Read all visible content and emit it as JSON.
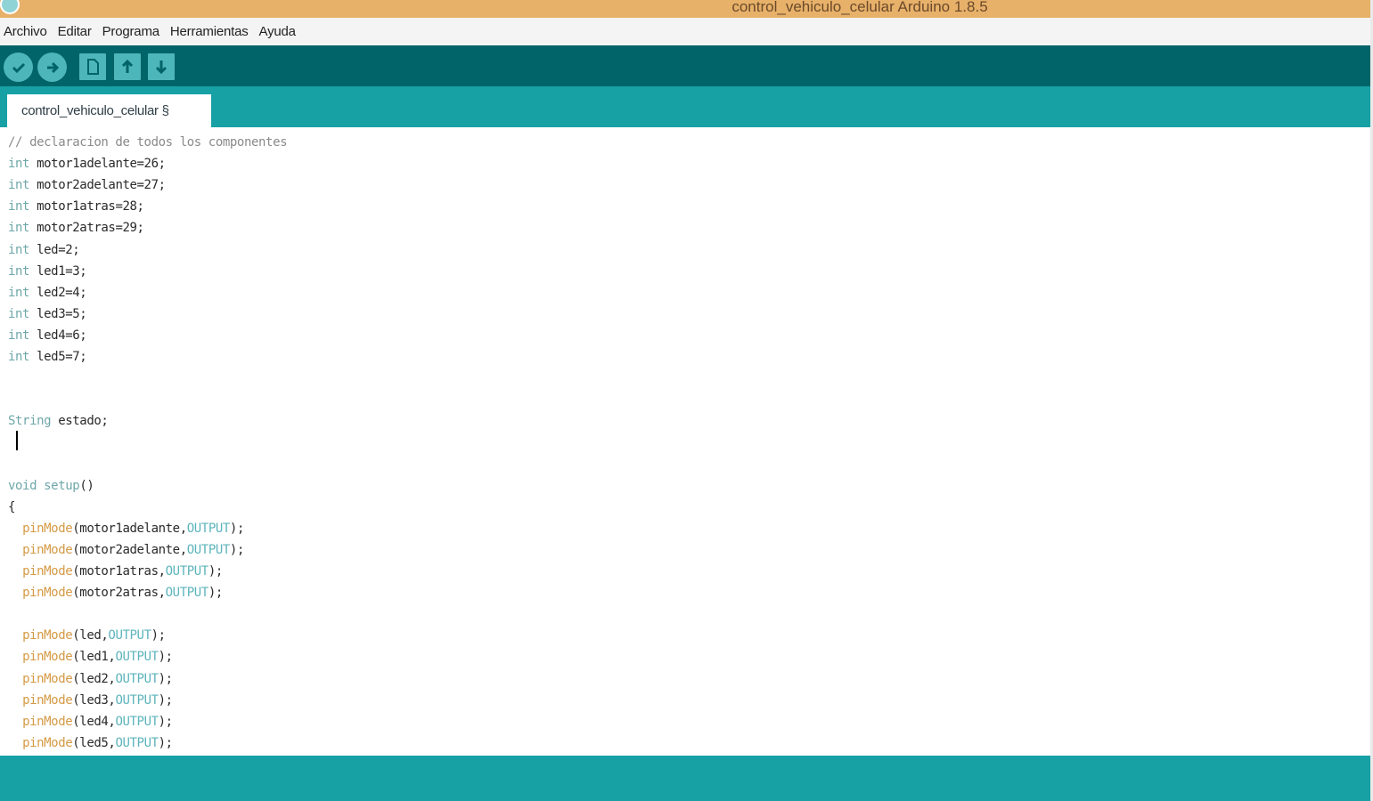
{
  "window": {
    "title": "control_vehiculo_celular Arduino 1.8.5"
  },
  "menu": [
    "Archivo",
    "Editar",
    "Programa",
    "Herramientas",
    "Ayuda"
  ],
  "toolbar": {
    "buttons": [
      {
        "name": "verify",
        "icon": "check-icon",
        "glyph": "✓"
      },
      {
        "name": "upload",
        "icon": "arrow-right-icon",
        "glyph": "➜"
      },
      {
        "name": "new",
        "icon": "file-icon",
        "glyph": "🗋"
      },
      {
        "name": "open",
        "icon": "arrow-up-icon",
        "glyph": "⬆"
      },
      {
        "name": "save",
        "icon": "arrow-down-icon",
        "glyph": "⬇"
      }
    ]
  },
  "tab": {
    "label": "control_vehiculo_celular §"
  },
  "colors": {
    "titlebar": "#e8b16a",
    "toolbar": "#006468",
    "tabbar": "#17a1a5",
    "keyword": "#6fa7a9",
    "function": "#d59a45",
    "constant": "#5cb4bb"
  },
  "code": [
    [
      {
        "t": "// declaracion de todos los componentes",
        "c": "cm"
      }
    ],
    [
      {
        "t": "int",
        "c": "kw"
      },
      {
        "t": " motor1adelante=26;"
      }
    ],
    [
      {
        "t": "int",
        "c": "kw"
      },
      {
        "t": " motor2adelante=27;"
      }
    ],
    [
      {
        "t": "int",
        "c": "kw"
      },
      {
        "t": " motor1atras=28;"
      }
    ],
    [
      {
        "t": "int",
        "c": "kw"
      },
      {
        "t": " motor2atras=29;"
      }
    ],
    [
      {
        "t": "int",
        "c": "kw"
      },
      {
        "t": " led=2;"
      }
    ],
    [
      {
        "t": "int",
        "c": "kw"
      },
      {
        "t": " led1=3;"
      }
    ],
    [
      {
        "t": "int",
        "c": "kw"
      },
      {
        "t": " led2=4;"
      }
    ],
    [
      {
        "t": "int",
        "c": "kw"
      },
      {
        "t": " led3=5;"
      }
    ],
    [
      {
        "t": "int",
        "c": "kw"
      },
      {
        "t": " led4=6;"
      }
    ],
    [
      {
        "t": "int",
        "c": "kw"
      },
      {
        "t": " led5=7;"
      }
    ],
    [],
    [],
    [
      {
        "t": "String",
        "c": "kw"
      },
      {
        "t": " estado;"
      }
    ],
    [],
    [],
    [
      {
        "t": "void",
        "c": "kw"
      },
      {
        "t": " "
      },
      {
        "t": "setup",
        "c": "kw"
      },
      {
        "t": "()"
      }
    ],
    [
      {
        "t": "{"
      }
    ],
    [
      {
        "t": "  "
      },
      {
        "t": "pinMode",
        "c": "fn"
      },
      {
        "t": "(motor1adelante,"
      },
      {
        "t": "OUTPUT",
        "c": "const"
      },
      {
        "t": ");"
      }
    ],
    [
      {
        "t": "  "
      },
      {
        "t": "pinMode",
        "c": "fn"
      },
      {
        "t": "(motor2adelante,"
      },
      {
        "t": "OUTPUT",
        "c": "const"
      },
      {
        "t": ");"
      }
    ],
    [
      {
        "t": "  "
      },
      {
        "t": "pinMode",
        "c": "fn"
      },
      {
        "t": "(motor1atras,"
      },
      {
        "t": "OUTPUT",
        "c": "const"
      },
      {
        "t": ");"
      }
    ],
    [
      {
        "t": "  "
      },
      {
        "t": "pinMode",
        "c": "fn"
      },
      {
        "t": "(motor2atras,"
      },
      {
        "t": "OUTPUT",
        "c": "const"
      },
      {
        "t": ");"
      }
    ],
    [],
    [
      {
        "t": "  "
      },
      {
        "t": "pinMode",
        "c": "fn"
      },
      {
        "t": "(led,"
      },
      {
        "t": "OUTPUT",
        "c": "const"
      },
      {
        "t": ");"
      }
    ],
    [
      {
        "t": "  "
      },
      {
        "t": "pinMode",
        "c": "fn"
      },
      {
        "t": "(led1,"
      },
      {
        "t": "OUTPUT",
        "c": "const"
      },
      {
        "t": ");"
      }
    ],
    [
      {
        "t": "  "
      },
      {
        "t": "pinMode",
        "c": "fn"
      },
      {
        "t": "(led2,"
      },
      {
        "t": "OUTPUT",
        "c": "const"
      },
      {
        "t": ");"
      }
    ],
    [
      {
        "t": "  "
      },
      {
        "t": "pinMode",
        "c": "fn"
      },
      {
        "t": "(led3,"
      },
      {
        "t": "OUTPUT",
        "c": "const"
      },
      {
        "t": ");"
      }
    ],
    [
      {
        "t": "  "
      },
      {
        "t": "pinMode",
        "c": "fn"
      },
      {
        "t": "(led4,"
      },
      {
        "t": "OUTPUT",
        "c": "const"
      },
      {
        "t": ");"
      }
    ],
    [
      {
        "t": "  "
      },
      {
        "t": "pinMode",
        "c": "fn"
      },
      {
        "t": "(led5,"
      },
      {
        "t": "OUTPUT",
        "c": "const"
      },
      {
        "t": ");"
      }
    ]
  ]
}
